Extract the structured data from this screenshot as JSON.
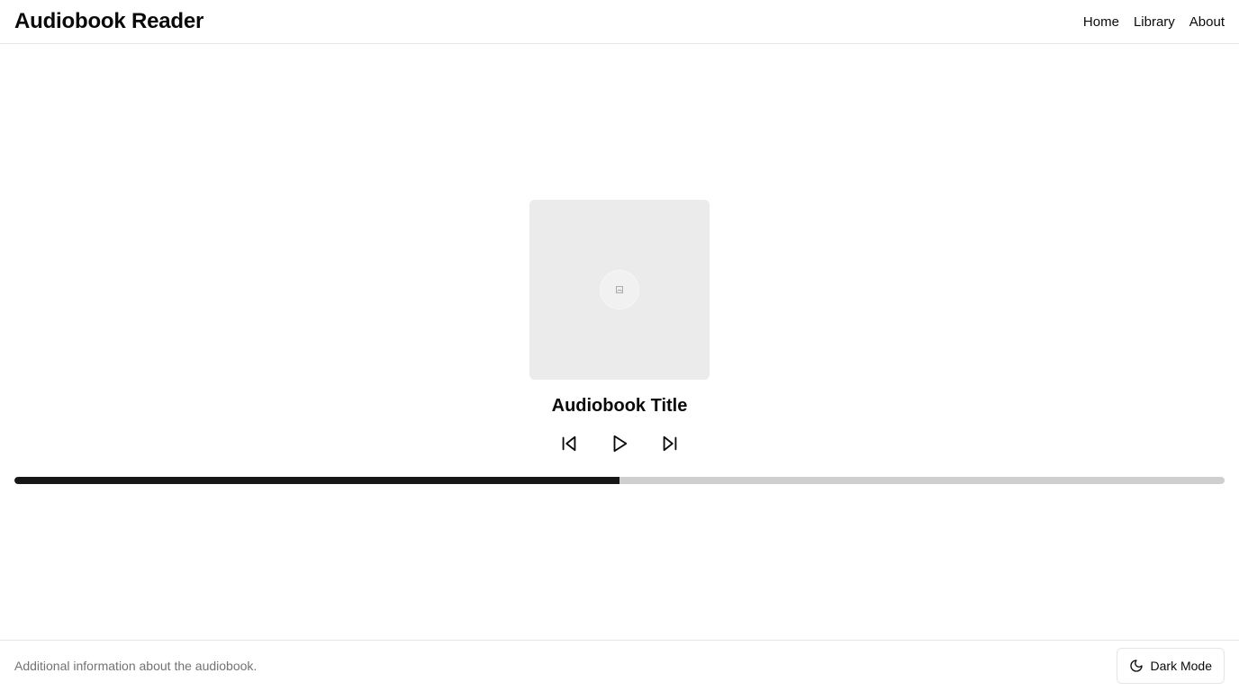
{
  "header": {
    "title": "Audiobook Reader",
    "nav": [
      "Home",
      "Library",
      "About"
    ]
  },
  "player": {
    "cover_icon": "image-placeholder-icon",
    "title": "Audiobook Title",
    "controls": {
      "previous_icon": "skip-back-icon",
      "play_icon": "play-icon",
      "next_icon": "skip-forward-icon"
    },
    "progress_fraction": 0.5
  },
  "footer": {
    "info": "Additional information about the audiobook.",
    "dark_mode_label": "Dark Mode",
    "dark_mode_icon": "moon-icon"
  },
  "colors": {
    "progress_fill": "#171717",
    "progress_track": "#cfcfcf",
    "cover_bg": "#ebebeb",
    "muted_text": "#737373"
  }
}
